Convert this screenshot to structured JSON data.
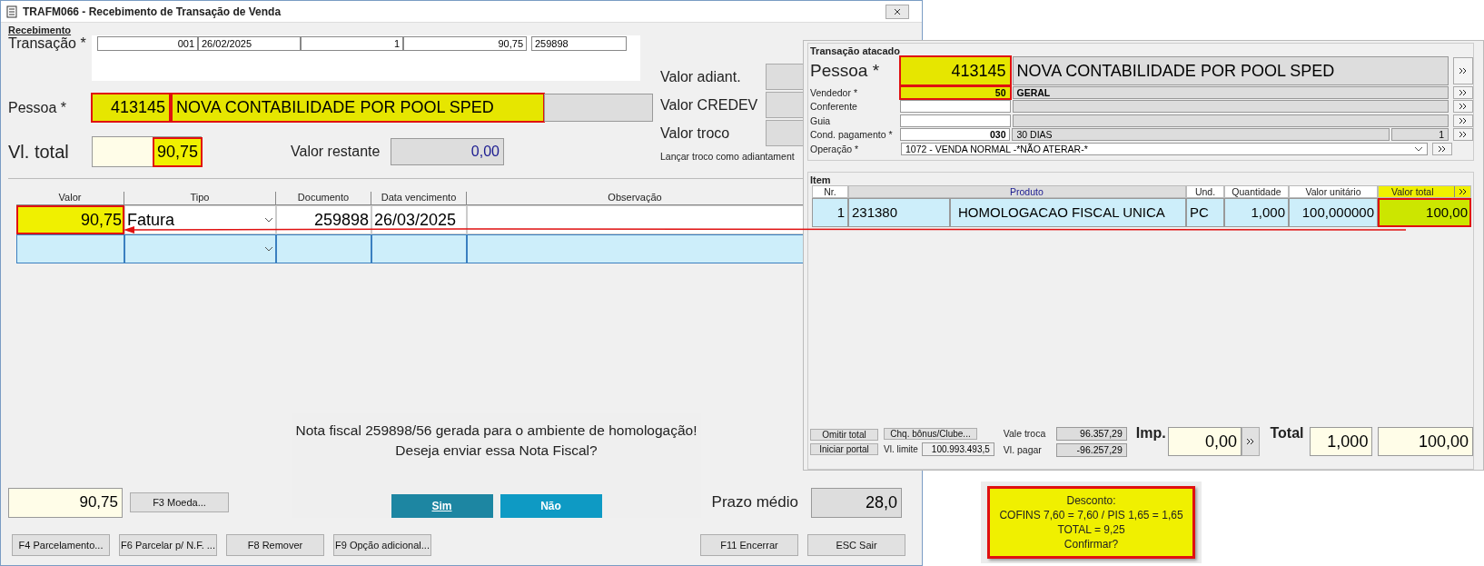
{
  "main_window": {
    "title": "TRAFM066 - Recebimento de Transação de Venda",
    "group_title": "Recebimento",
    "transacao": {
      "label": "Transação *",
      "cells": [
        "001",
        "26/02/2025",
        "1",
        "90,75",
        "259898"
      ]
    },
    "pessoa": {
      "label": "Pessoa *",
      "code": "413145",
      "name": "NOVA CONTABILIDADE POR POOL SPED",
      "highlighted": true
    },
    "total": {
      "label": "Vl. total",
      "value": "90,75",
      "highlighted": true
    },
    "restante": {
      "label": "Valor restante",
      "value": "0,00"
    },
    "side_fields": [
      {
        "label": "Valor adiant."
      },
      {
        "label": "Valor CREDEV"
      },
      {
        "label": "Valor troco"
      }
    ],
    "troco_option": "Lançar troco como adiantament",
    "grid": {
      "columns": [
        "Valor",
        "Tipo",
        "Documento",
        "Data vencimento",
        "Observação"
      ],
      "rows": [
        {
          "valor": "90,75",
          "tipo": "Fatura",
          "documento": "259898",
          "vencimento": "26/03/2025",
          "highlighted": true,
          "selected": false
        },
        {
          "selected": true,
          "highlighted": false
        }
      ]
    },
    "footer_total": "90,75",
    "moeda_button": "F3 Moeda...",
    "prazo": {
      "label": "Prazo médio",
      "value": "28,0"
    },
    "buttons": [
      "F4 Parcelamento...",
      "F6 Parcelar p/ N.F. ...",
      "F8 Remover",
      "F9 Opção adicional...",
      "F11 Encerrar",
      "ESC Sair"
    ]
  },
  "wholesale_window": {
    "group_title": "Transação atacado",
    "pessoa": {
      "label": "Pessoa *",
      "code": "413145",
      "name": "NOVA CONTABILIDADE POR POOL SPED",
      "highlighted": true
    },
    "fields": [
      {
        "kind": "lookup",
        "label": "Vendedor *",
        "code": "50",
        "name": "GERAL",
        "highlighted": true
      },
      {
        "kind": "lookup",
        "label": "Conferente",
        "highlighted": false
      },
      {
        "kind": "lookup",
        "label": "Guia",
        "highlighted": false
      },
      {
        "kind": "lookup",
        "label": "Cond. pagamento *",
        "code": "030",
        "name": "30 DIAS",
        "extra": "1",
        "highlighted": false
      },
      {
        "kind": "select",
        "label": "Operação *",
        "value": "1072 - VENDA NORMAL -*NÃO ATERAR-*"
      }
    ],
    "item_group": "Item",
    "item_table": {
      "columns": [
        "Nr.",
        "",
        "Produto",
        "Und.",
        "Quantidade",
        "Valor unitário",
        "Valor total"
      ],
      "rows": [
        {
          "cells": [
            "1",
            "231380",
            "HOMOLOGACAO FISCAL UNICA",
            "PC",
            "1,000",
            "100,000000",
            "100,00"
          ],
          "highlighted": true
        }
      ]
    },
    "buttons": [
      "Omitir total",
      "Iniciar portal",
      "Chq. bônus/Clube..."
    ],
    "limite": {
      "label": "Vl. limite",
      "value": "100.993.493,5"
    },
    "vale_troca": {
      "label": "Vale troca",
      "value": "96.357,29"
    },
    "vl_pagar": {
      "label": "Vl. pagar",
      "value": "-96.257,29"
    },
    "imp": {
      "label": "Imp.",
      "value": "0,00"
    },
    "total": {
      "label": "Total",
      "quantity": "1,000",
      "value": "100,00"
    }
  },
  "dialog": {
    "message": [
      "Nota fiscal 259898/56 gerada para o ambiente de homologação!",
      "Deseja enviar essa Nota Fiscal?"
    ],
    "buttons": [
      {
        "label": "Sim",
        "selected": true
      },
      {
        "label": "Não",
        "selected": false
      }
    ]
  },
  "note": {
    "lines": [
      "Desconto:",
      "COFINS 7,60 = 7,60 / PIS 1,65 = 1,65",
      "TOTAL = 9,25",
      "Confirmar?"
    ]
  }
}
